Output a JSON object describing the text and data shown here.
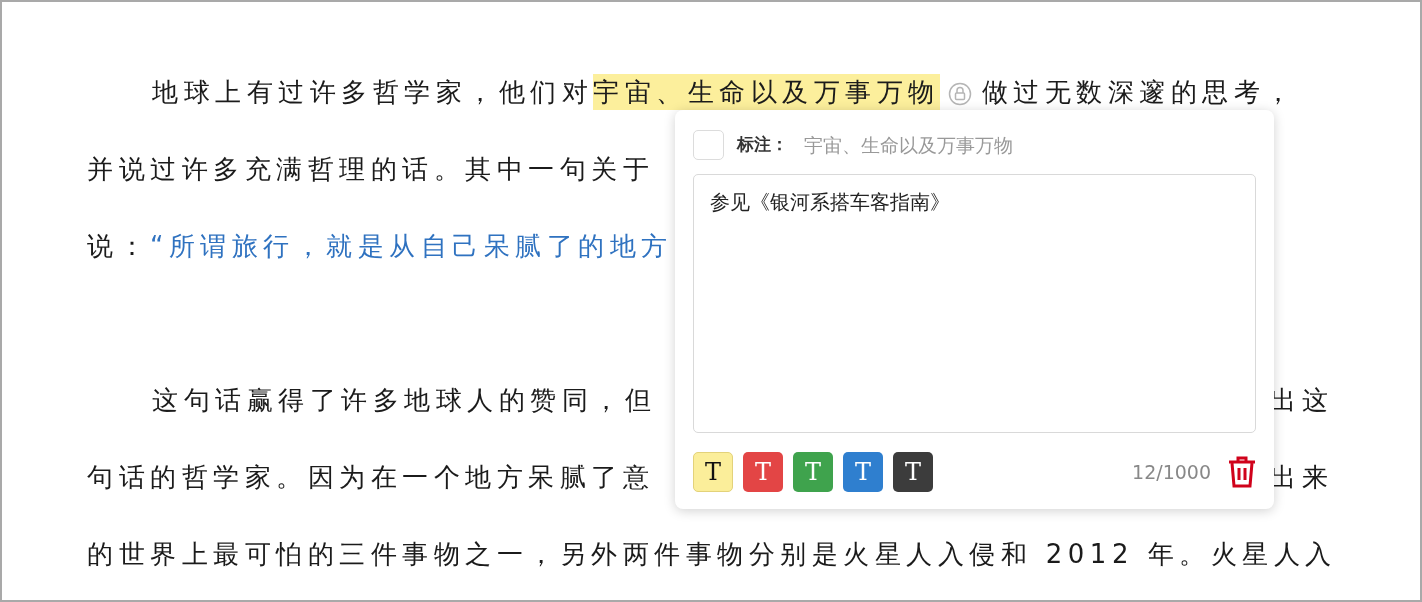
{
  "paragraphs": [
    {
      "lines": [
        {
          "indent": true,
          "segments": [
            {
              "kind": "plain",
              "text": "地球上有过许多哲学家，他们对"
            },
            {
              "kind": "highlight",
              "text": "宇宙、生命以及万事万物"
            },
            {
              "kind": "marker"
            },
            {
              "kind": "plain",
              "text": "做过无数深邃的思考，"
            }
          ]
        },
        {
          "indent": false,
          "segments": [
            {
              "kind": "plain",
              "text": "并说过许多充满哲理的话。其中一句关于"
            }
          ]
        },
        {
          "indent": false,
          "segments": [
            {
              "kind": "plain",
              "text": "说："
            },
            {
              "kind": "quote",
              "text": "“所谓旅行，就是从自己呆腻了的地方"
            }
          ]
        }
      ]
    },
    {
      "lines": [
        {
          "indent": true,
          "segments": [
            {
              "kind": "plain",
              "text": "这句话赢得了许多地球人的赞同，但"
            }
          ],
          "right_text": "出这"
        },
        {
          "indent": false,
          "segments": [
            {
              "kind": "plain",
              "text": "句话的哲学家。因为在一个地方呆腻了意"
            }
          ],
          "right_text": "出来"
        },
        {
          "indent": false,
          "segments": [
            {
              "kind": "plain",
              "text": "的世界上最可怕的三件事物之一，另外两件事物分别是火星人入侵和 2012 年。火星人入"
            }
          ]
        }
      ]
    }
  ],
  "annotation_popup": {
    "checked": false,
    "label": "标注：",
    "quoted_text": "宇宙、生命以及万事万物",
    "note": "参见《银河系搭车客指南》",
    "colors": [
      {
        "text": "T",
        "color": "#fbee9a"
      },
      {
        "text": "T",
        "color": "#e34545"
      },
      {
        "text": "T",
        "color": "#3fa34d"
      },
      {
        "text": "T",
        "color": "#2f7fcf"
      },
      {
        "text": "T",
        "color": "#3c3c3c"
      }
    ],
    "counter": "12/1000"
  }
}
